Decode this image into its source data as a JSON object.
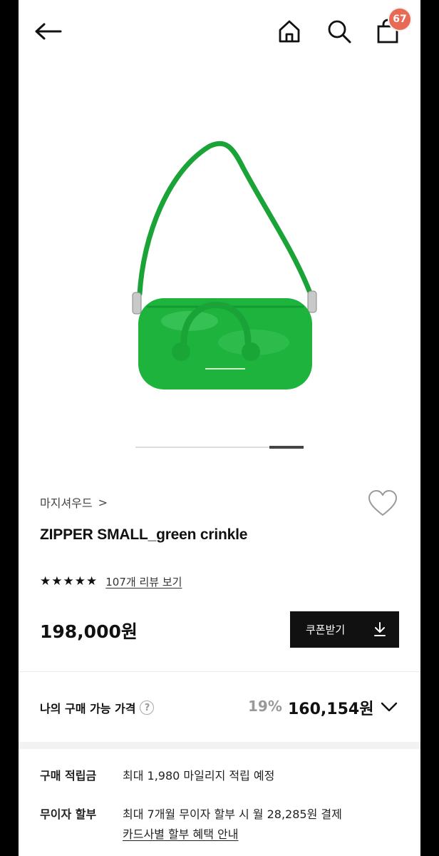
{
  "header": {
    "back_icon": "arrow-left-icon",
    "home_icon": "home-icon",
    "search_icon": "search-icon",
    "cart_icon": "shopping-bag-icon",
    "cart_badge": "67"
  },
  "product": {
    "image_alt": "green crinkle leather zipper bag",
    "image_color": "#1db33d",
    "brand": "마지셔우드",
    "brand_chevron": ">",
    "title": "ZIPPER SMALL_green crinkle",
    "rating": 5,
    "review_link": "107개 리뷰 보기",
    "price": "198,000원",
    "coupon_label": "쿠폰받기"
  },
  "my_price": {
    "label": "나의 구매 가능 가격",
    "help": "?",
    "discount": "19%",
    "final_price": "160,154원"
  },
  "info": {
    "points_label": "구매 적립금",
    "points_value": "최대 1,980 마일리지 적립 예정",
    "installment_label": "무이자 할부",
    "installment_value": "최대 7개월 무이자 할부 시 월 28,285원 결제",
    "card_link": "카드사별 할부 혜택 안내"
  },
  "colors": {
    "accent": "#111111",
    "badge": "#e86a55",
    "discount": "#999999"
  }
}
